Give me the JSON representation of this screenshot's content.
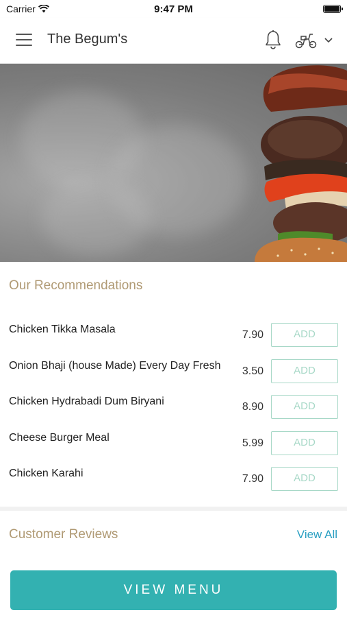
{
  "status_bar": {
    "carrier": "Carrier",
    "time": "9:47 PM"
  },
  "header": {
    "title": "The Begum's"
  },
  "icons": {
    "menu": "hamburger-menu-icon",
    "notifications": "bell-icon",
    "delivery": "scooter-icon",
    "dropdown": "chevron-down-icon"
  },
  "recommendations": {
    "title": "Our Recommendations",
    "add_label": "ADD",
    "items": [
      {
        "name": "Chicken Tikka Masala",
        "price": "7.90"
      },
      {
        "name": "Onion Bhaji (house Made) Every Day Fresh",
        "price": "3.50"
      },
      {
        "name": "Chicken Hydrabadi Dum Biryani",
        "price": "8.90"
      },
      {
        "name": "Cheese Burger Meal",
        "price": "5.99"
      },
      {
        "name": "Chicken Karahi",
        "price": "7.90"
      }
    ]
  },
  "reviews": {
    "title": "Customer Reviews",
    "view_all": "View All"
  },
  "footer": {
    "view_menu": "VIEW MENU"
  },
  "colors": {
    "accent": "#33b1b1",
    "section_title": "#b09a74",
    "add_button": "#a7d8c7",
    "link": "#2a9fc2"
  }
}
